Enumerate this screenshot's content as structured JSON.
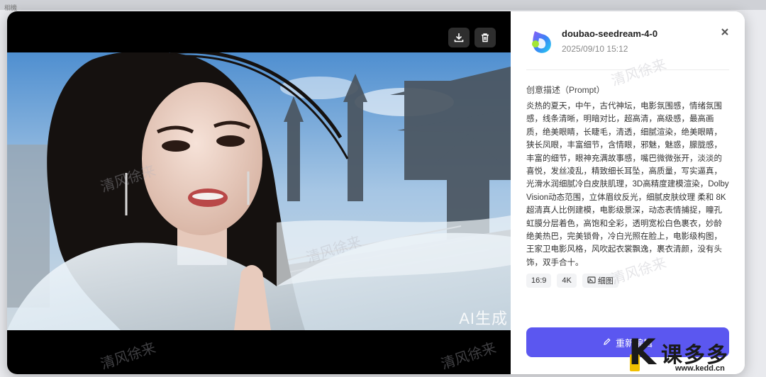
{
  "backdrop": {
    "label": "相機"
  },
  "viewer": {
    "ai_watermark": "AI生成",
    "download_icon": "download-icon",
    "delete_icon": "trash-icon"
  },
  "panel": {
    "model_name": "doubao-seedream-4-0",
    "date": "2025/09/10 15:12",
    "close_icon": "close-icon",
    "prompt_title": "创意描述（Prompt）",
    "prompt_text": "炎热的夏天，中午，古代神坛，电影氛围感，情绪氛围感，线条清晰，明暗对比，超高清，高级感，最高画质，绝美眼睛，长睫毛，清透，细腻渲染，绝美眼睛，狭长凤眼，丰富细节，含情眼，邪魅，魅惑，朦胧感，丰富的细节，眼神充满故事感，嘴巴微微张开，淡淡的喜悦，发丝凌乱，精致细长耳坠，高质量，写实逼真，光滑水润细腻冷白皮肤肌理，3D高精度建模渲染，Dolby Vision动态范围，立体眉纹反光，细腻皮肤纹理 柔和 8K超清真人比例建模，电影级景深，动态表情捕捉，瞳孔虹膜分层着色，高饱和全彩，透明宽松白色裹衣，妙龄绝美热巴，完美锁骨，冷白光照在脸上，电影级构图，王家卫电影风格，风吹起衣裳飘逸，裹衣清颜，没有头饰，双手合十。",
    "tags": [
      "16:9",
      "4K",
      "细图"
    ],
    "regenerate_label": "重新编辑"
  },
  "watermark_text": "清风徐来",
  "brand": {
    "cn": "课多多",
    "url": "www.kedd.cn"
  },
  "colors": {
    "accent": "#5b57f0",
    "viewer_bg": "#000000",
    "tool_btn": "#2e2e2e"
  }
}
